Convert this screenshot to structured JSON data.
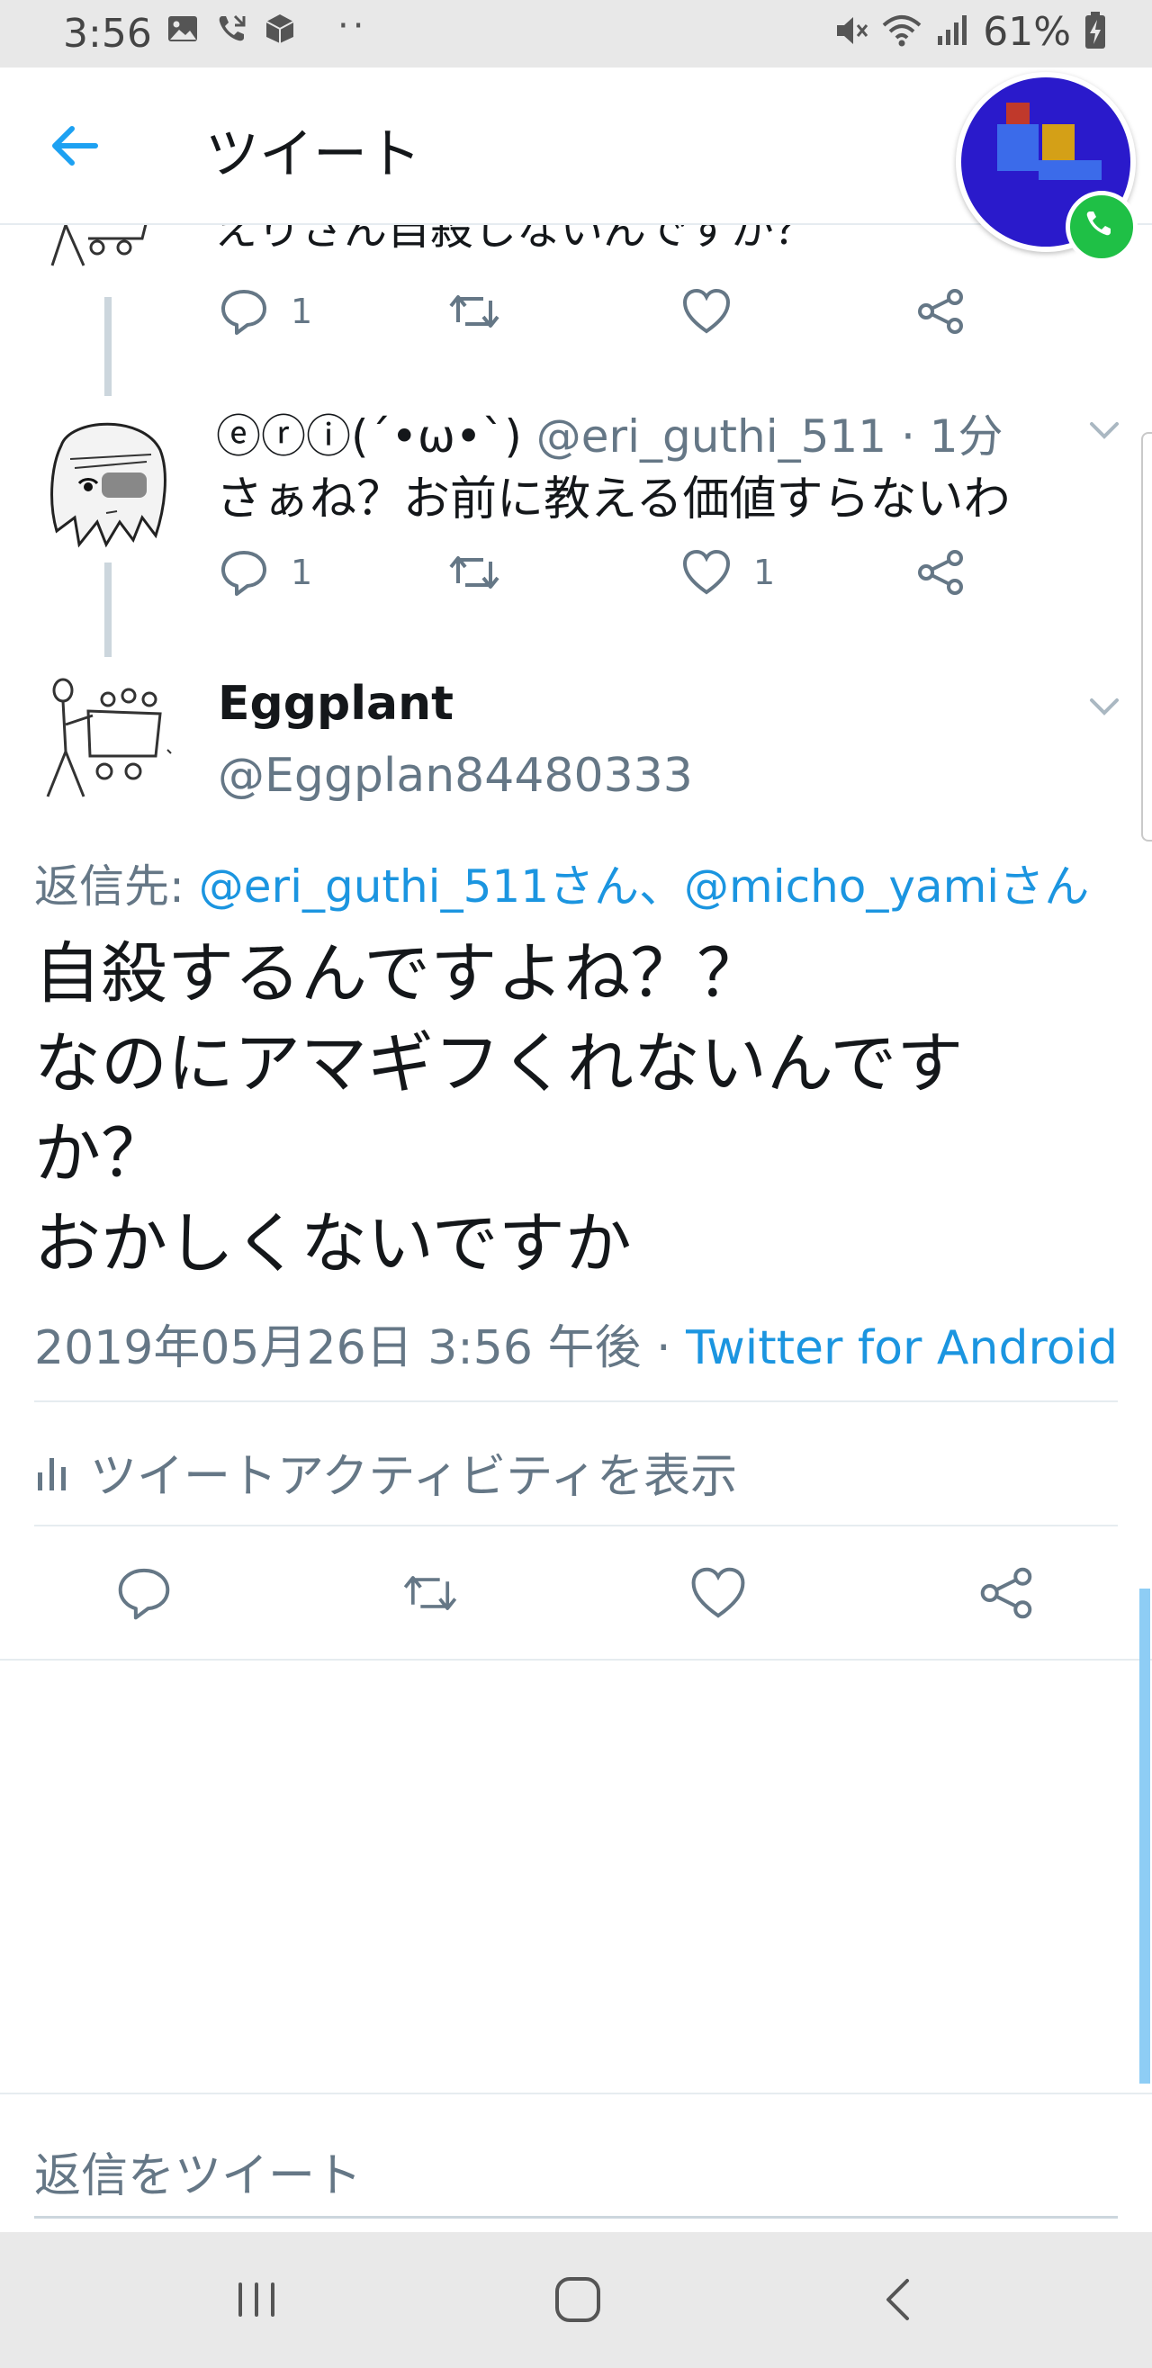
{
  "status_bar": {
    "time": "3:56",
    "battery": "61%",
    "dots": "··"
  },
  "header": {
    "title": "ツイート"
  },
  "thread": {
    "partial_tweet_text": "えりさん自殺しないんですか？",
    "partial_tweet_reply_count": "1",
    "reply_tweet": {
      "name": "ⓔⓡⓘ(´•ω•`)",
      "handle": "@eri_guthi_511",
      "time": "· 1分",
      "text": "さぁね？お前に教える価値すらないわ",
      "reply_count": "1",
      "like_count": "1"
    }
  },
  "main_tweet": {
    "name": "Eggplant",
    "handle": "@Eggplan84480333",
    "reply_to_label": "返信先: ",
    "reply_to_users": "@eri_guthi_511さん、@micho_yamiさん",
    "text_lines": [
      "自殺するんですよね？？",
      "なのにアマギフくれないんです",
      "か？",
      "おかしくないですか"
    ],
    "timestamp": "2019年05月26日 3:56 午後 · ",
    "source": "Twitter for Android",
    "activity_label": "ツイートアクティビティを表示"
  },
  "reply_box": {
    "placeholder": "返信をツイート"
  },
  "colors": {
    "link": "#1b95e0",
    "secondary_text": "#657786",
    "icon": "#657786",
    "call_green": "#1fc046",
    "avatar_bg": "#2a1acb"
  }
}
